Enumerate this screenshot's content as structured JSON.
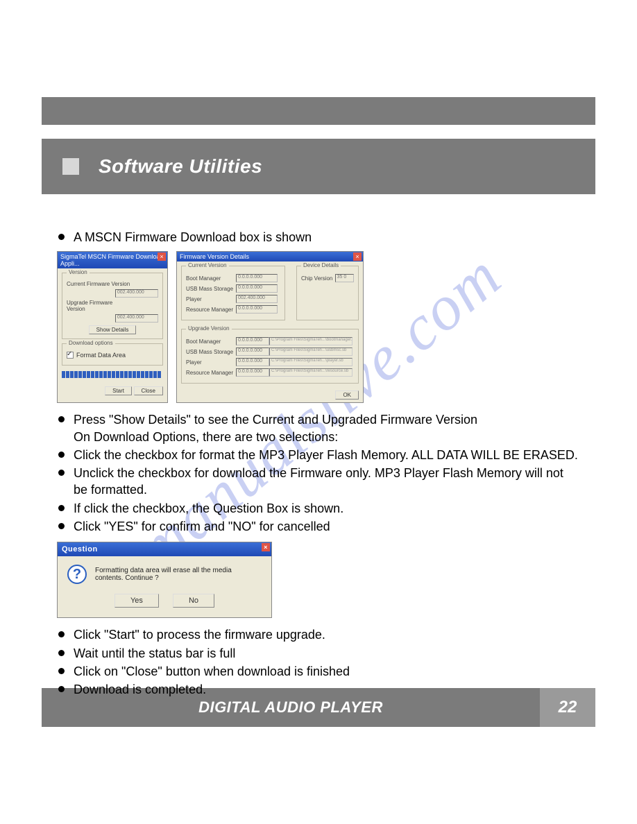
{
  "watermark": "manualslive.com",
  "header": {
    "title": "Software Utilities"
  },
  "bullets_a": [
    "A MSCN Firmware Download box is shown"
  ],
  "dlg1": {
    "title": "SigmaTel MSCN Firmware Download Appli...",
    "grp_version": "Version",
    "current_label": "Current Firmware Version",
    "current_value": "002.400.000",
    "upgrade_label": "Upgrade Firmware Version",
    "upgrade_value": "002.400.000",
    "show_details": "Show Details",
    "grp_download": "Download options",
    "format_label": "Format Data Area",
    "start": "Start",
    "close": "Close"
  },
  "dlg2": {
    "title": "Firmware Version Details",
    "grp_current": "Current Version",
    "grp_device": "Device Details",
    "dev_label": "Chip Version",
    "dev_value": "35   0",
    "bootmgr": "Boot Manager",
    "usbmass": "USB Mass Storage",
    "player": "Player",
    "resmgr": "Resource Manager",
    "grp_upgrade": "Upgrade Version",
    "ok": "OK",
    "v1": "0.0.0.0.000",
    "v2": "0.0.0.0.000",
    "v3": "002.400.000",
    "v4": "0.0.0.0.000",
    "u1": "0.0.0.0.000",
    "u2": "0.0.0.0.000",
    "u3": "0.0.0.0.000",
    "u4": "0.0.0.0.000",
    "p1": "C:\\Program Files\\SigmaTel\\...\\bootmanager.sb",
    "p2": "C:\\Program Files\\SigmaTel\\...\\usbmsc.sb",
    "p3": "C:\\Program Files\\SigmaTel\\...\\player.sb",
    "p4": "C:\\Program Files\\SigmaTel\\...\\resource.sb"
  },
  "bullets_b": [
    {
      "main": "Press \"Show Details\" to see the Current and Upgraded Firmware Version",
      "sub": "On Download Options, there are two selections:"
    },
    {
      "main": "Click the checkbox for format the MP3 Player Flash Memory. ALL DATA WILL BE ERASED."
    },
    {
      "main": "Unclick the checkbox for download the Firmware only. MP3 Player Flash Memory will not be formatted."
    },
    {
      "main": "If click the checkbox, the Question Box is shown."
    },
    {
      "main": "Click \"YES\" for confirm and \"NO\" for cancelled"
    }
  ],
  "question": {
    "title": "Question",
    "message": "Formatting data area will erase all the media contents. Continue ?",
    "yes": "Yes",
    "no": "No"
  },
  "bullets_c": [
    "Click \"Start\" to process the firmware upgrade.",
    "Wait until the status bar is full",
    "Click on \"Close\" button when download is finished",
    "Download is completed."
  ],
  "footer": {
    "title": "DIGITAL AUDIO PLAYER",
    "page": "22"
  }
}
